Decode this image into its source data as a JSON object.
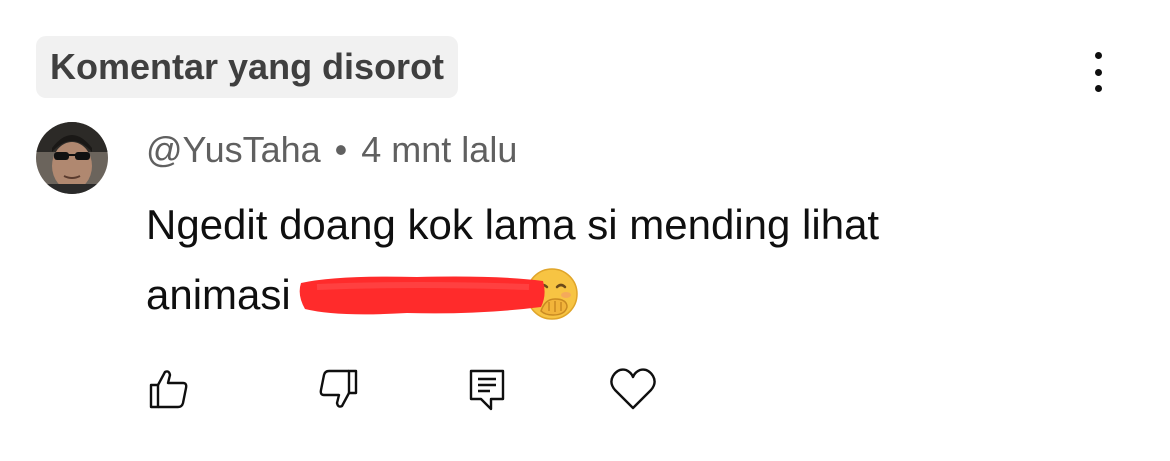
{
  "header": {
    "section_label": "Komentar yang disorot",
    "more_icon": "more-vert-icon"
  },
  "comment": {
    "author": "@YusTaha",
    "separator": "•",
    "time": "4 mnt lalu",
    "text_line_1": "Ngedit doang kok lama si mending lihat",
    "text_line_2_prefix": "animasi",
    "redaction_color": "#ff2b2b",
    "emoji": "face-with-hand-over-mouth"
  },
  "actions": {
    "icons": [
      "thumbs-up-icon",
      "thumbs-down-icon",
      "reply-icon",
      "heart-icon"
    ]
  }
}
